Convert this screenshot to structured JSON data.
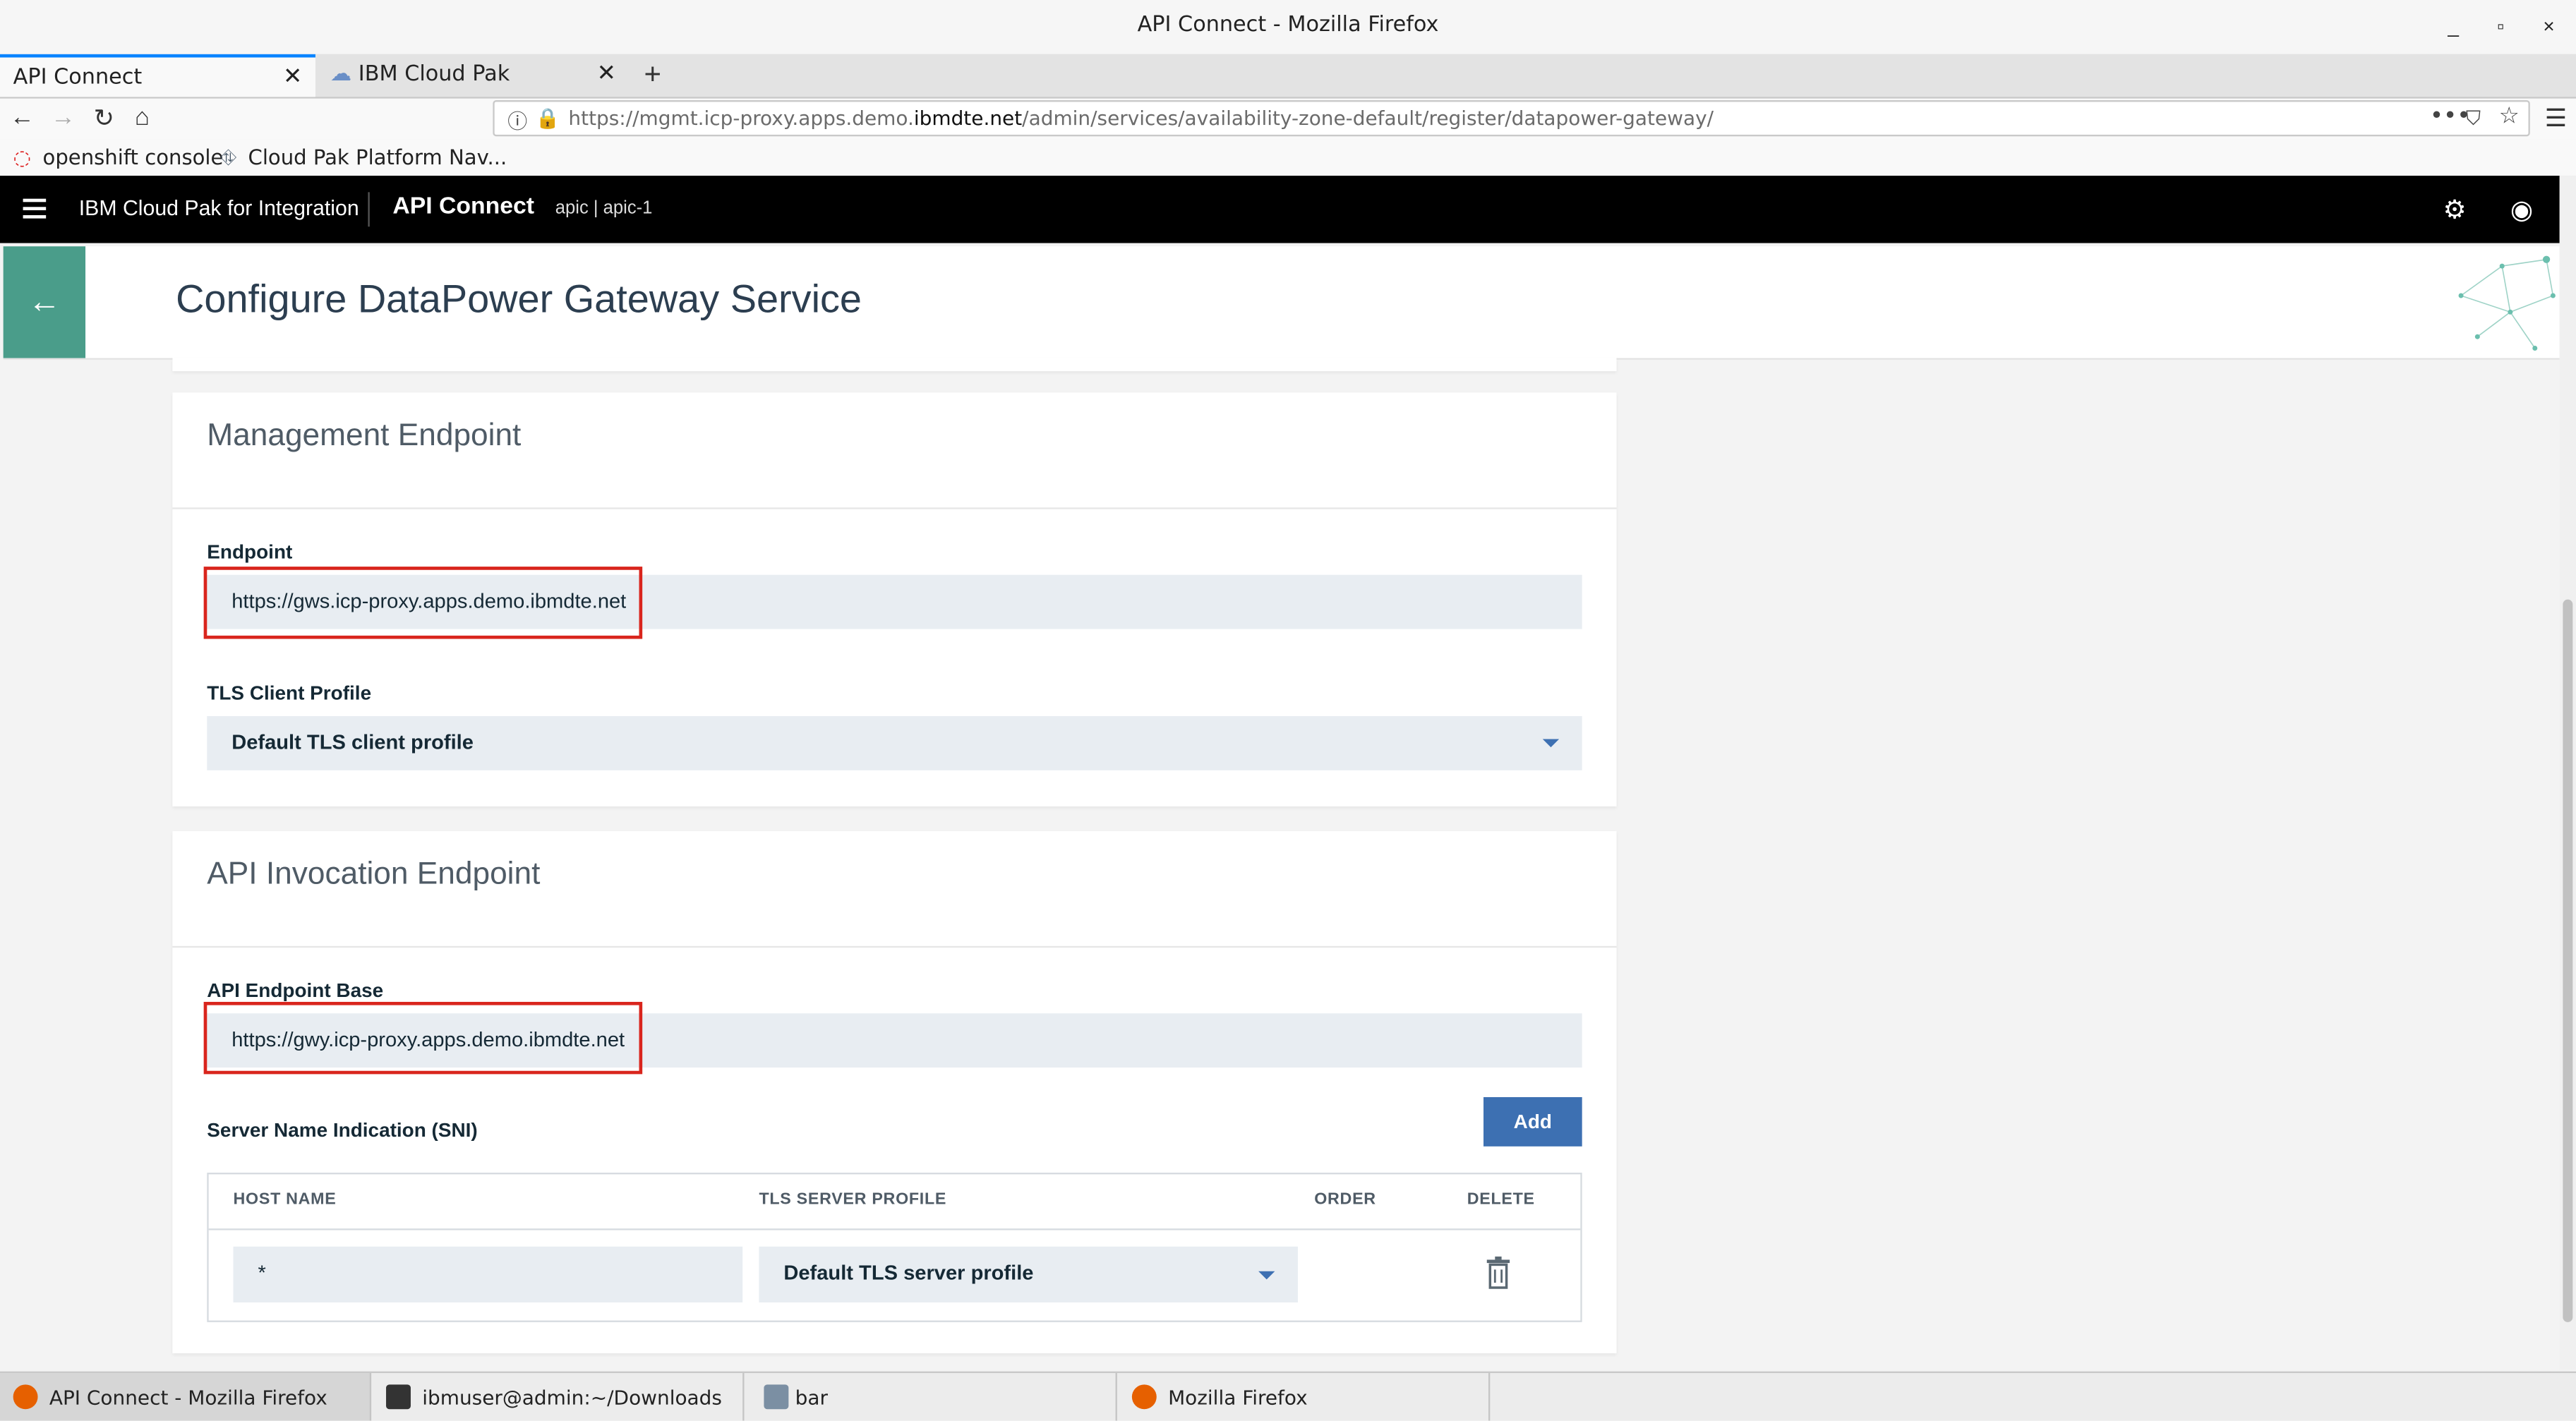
{
  "window": {
    "title": "API Connect - Mozilla Firefox",
    "controls": [
      "_",
      "▫",
      "×"
    ]
  },
  "browser": {
    "tabs": [
      {
        "label": "API Connect"
      },
      {
        "label": "IBM Cloud Pak"
      }
    ],
    "url": {
      "prefix": "https://mgmt.icp-proxy.apps.demo.",
      "domain": "ibmdte.net",
      "suffix": "/admin/services/availability-zone-default/register/datapower-gateway/"
    },
    "bookmarks": [
      "openshift console",
      "Cloud Pak Platform Nav..."
    ]
  },
  "header": {
    "product": "IBM Cloud Pak for Integration",
    "app": "API Connect",
    "context": "apic | apic-1"
  },
  "page": {
    "title": "Configure DataPower Gateway Service"
  },
  "management": {
    "heading": "Management Endpoint",
    "endpoint_label": "Endpoint",
    "endpoint_value": "https://gws.icp-proxy.apps.demo.ibmdte.net",
    "tls_label": "TLS Client Profile",
    "tls_value": "Default TLS client profile"
  },
  "invocation": {
    "heading": "API Invocation Endpoint",
    "base_label": "API Endpoint Base",
    "base_value": "https://gwy.icp-proxy.apps.demo.ibmdte.net",
    "sni_label": "Server Name Indication (SNI)",
    "add_label": "Add",
    "columns": [
      "HOST NAME",
      "TLS SERVER PROFILE",
      "ORDER",
      "DELETE"
    ],
    "row": {
      "host": "*",
      "profile": "Default TLS server profile"
    }
  },
  "taskbar": [
    {
      "label": "API Connect - Mozilla Firefox"
    },
    {
      "label": "ibmuser@admin:~/Downloads"
    },
    {
      "label": "bar"
    },
    {
      "label": "Mozilla Firefox"
    }
  ],
  "colors": {
    "accent": "#3d70b2",
    "back": "#4a9d8a",
    "highlight": "#d9251d"
  }
}
